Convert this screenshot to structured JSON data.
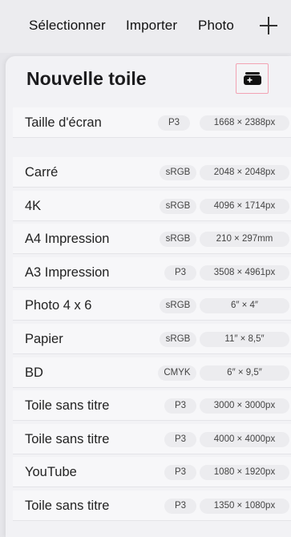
{
  "toolbar": {
    "select_label": "Sélectionner",
    "import_label": "Importer",
    "photo_label": "Photo",
    "add_icon": "plus-icon"
  },
  "panel": {
    "title": "Nouvelle toile",
    "new_button_icon": "new-canvas-icon",
    "highlight_color": "#f2a3b3"
  },
  "screen_size": {
    "label": "Taille d'écran",
    "colorspace": "P3",
    "dimensions": "1668 × 2388px"
  },
  "presets": [
    {
      "label": "Carré",
      "colorspace": "sRGB",
      "dimensions": "2048 × 2048px"
    },
    {
      "label": "4K",
      "colorspace": "sRGB",
      "dimensions": "4096 × 1714px"
    },
    {
      "label": "A4 Impression",
      "colorspace": "sRGB",
      "dimensions": "210 × 297mm"
    },
    {
      "label": "A3 Impression",
      "colorspace": "P3",
      "dimensions": "3508 × 4961px"
    },
    {
      "label": "Photo 4 x 6",
      "colorspace": "sRGB",
      "dimensions": "6″ × 4″"
    },
    {
      "label": "Papier",
      "colorspace": "sRGB",
      "dimensions": "11″ × 8,5″"
    },
    {
      "label": "BD",
      "colorspace": "CMYK",
      "dimensions": "6″ × 9,5″"
    },
    {
      "label": "Toile sans titre",
      "colorspace": "P3",
      "dimensions": "3000 × 3000px"
    },
    {
      "label": "Toile sans titre",
      "colorspace": "P3",
      "dimensions": "4000 × 4000px"
    },
    {
      "label": "YouTube",
      "colorspace": "P3",
      "dimensions": "1080 × 1920px"
    },
    {
      "label": "Toile sans titre",
      "colorspace": "P3",
      "dimensions": "1350 × 1080px"
    }
  ]
}
